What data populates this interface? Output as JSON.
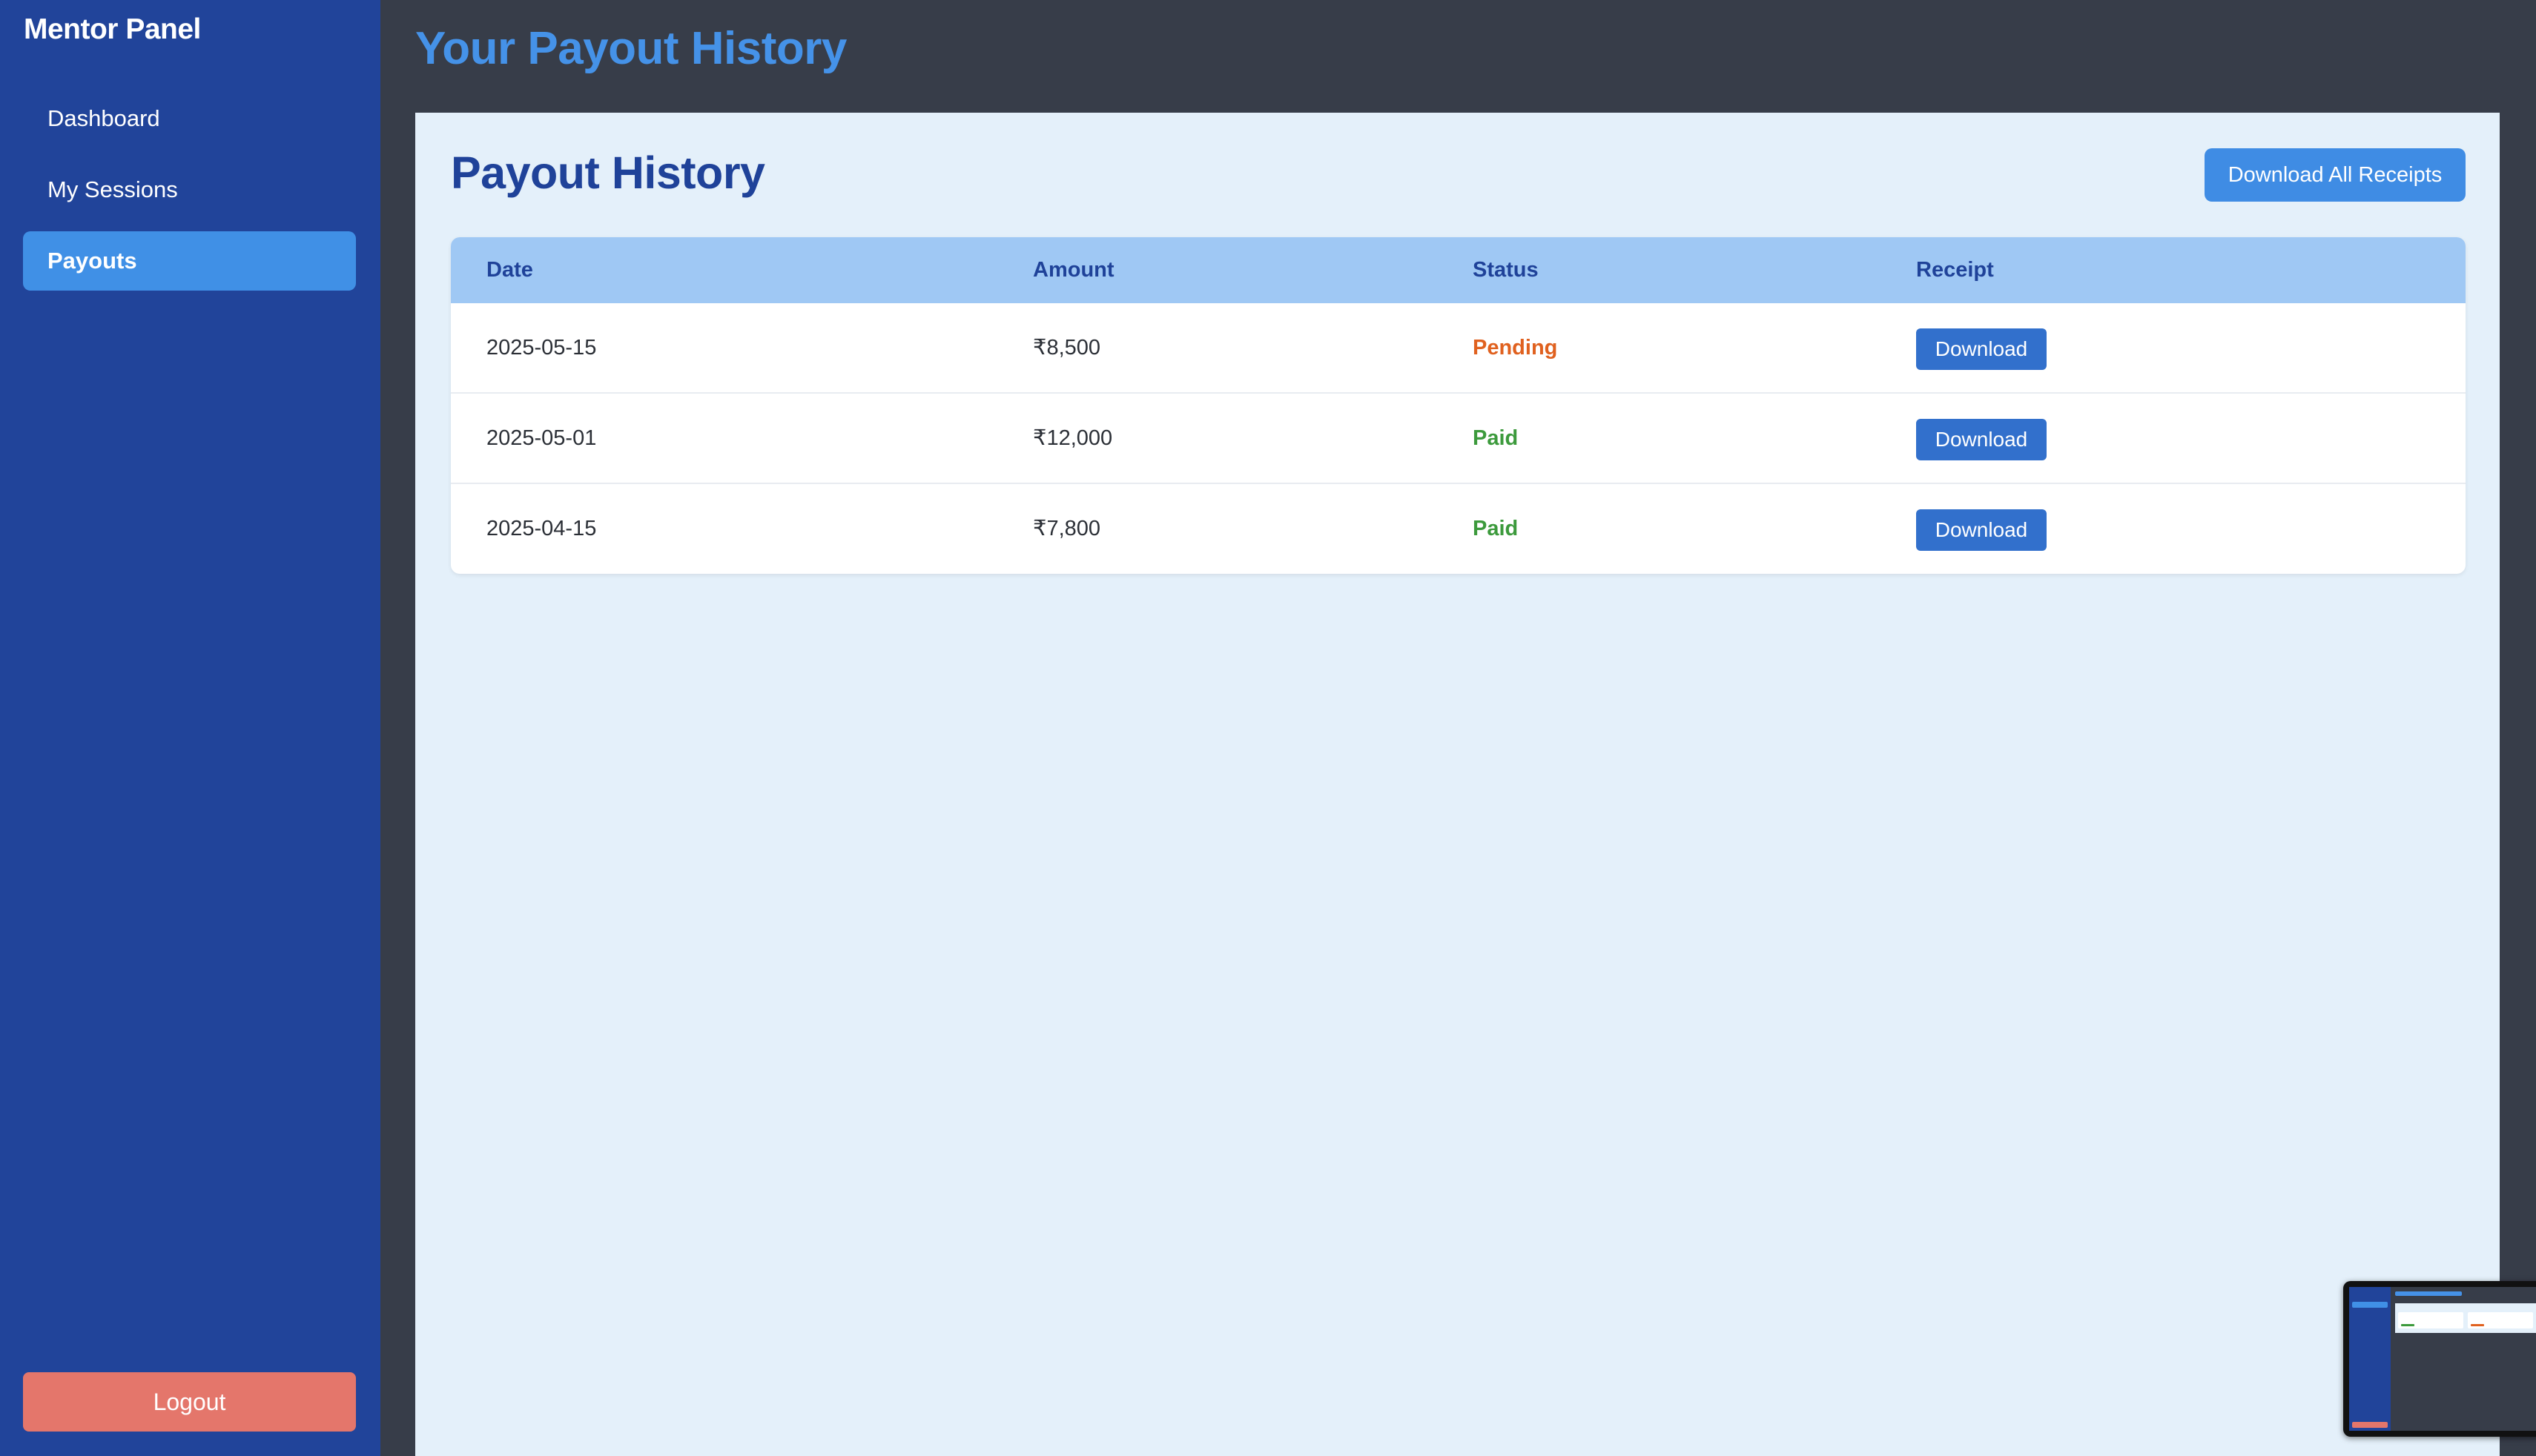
{
  "sidebar": {
    "brand": "Mentor Panel",
    "items": [
      {
        "label": "Dashboard",
        "active": false
      },
      {
        "label": "My Sessions",
        "active": false
      },
      {
        "label": "Payouts",
        "active": true
      }
    ],
    "logout_label": "Logout",
    "colors": {
      "background": "#21449a",
      "active": "#4090e6",
      "logout": "#e4766b"
    }
  },
  "header": {
    "title": "Your Payout History"
  },
  "main": {
    "title": "Payout History",
    "download_all_label": "Download All Receipts",
    "table": {
      "columns": [
        "Date",
        "Amount",
        "Status",
        "Receipt"
      ],
      "rows": [
        {
          "date": "2025-05-15",
          "amount": "₹8,500",
          "status": "Pending",
          "receipt": "Download"
        },
        {
          "date": "2025-05-01",
          "amount": "₹12,000",
          "status": "Paid",
          "receipt": "Download"
        },
        {
          "date": "2025-04-15",
          "amount": "₹7,800",
          "status": "Paid",
          "receipt": "Download"
        }
      ]
    },
    "status_colors": {
      "Pending": "#e0611f",
      "Paid": "#3c9a3c"
    }
  },
  "icons": [
    "download-all-receipts",
    "screen-preview-thumbnail"
  ]
}
